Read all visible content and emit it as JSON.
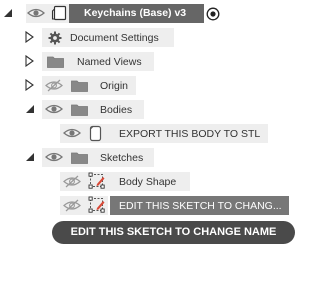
{
  "browser": {
    "root": {
      "label": "Keychains (Base) v3",
      "icons": [
        "collapse-arrow-icon",
        "eye-icon",
        "component-cube-icon",
        "active-radio-icon"
      ]
    },
    "items": [
      {
        "label": "Document Settings",
        "icons": [
          "expand-arrow-icon",
          "gear-icon"
        ]
      },
      {
        "label": "Named Views",
        "icons": [
          "expand-arrow-icon",
          "folder-icon"
        ]
      },
      {
        "label": "Origin",
        "icons": [
          "expand-arrow-icon",
          "eye-hidden-icon",
          "folder-icon"
        ]
      },
      {
        "label": "Bodies",
        "icons": [
          "collapse-arrow-icon",
          "eye-icon",
          "folder-icon"
        ]
      },
      {
        "label": "EXPORT THIS BODY TO STL",
        "icons": [
          "eye-icon",
          "body-icon"
        ]
      },
      {
        "label": "Sketches",
        "icons": [
          "collapse-arrow-icon",
          "eye-icon",
          "folder-icon"
        ]
      },
      {
        "label": "Body Shape",
        "icons": [
          "eye-hidden-icon",
          "sketch-icon"
        ]
      },
      {
        "label": "EDIT THIS SKETCH TO CHANG...",
        "state": "selected",
        "icons": [
          "eye-hidden-icon",
          "sketch-icon"
        ]
      }
    ]
  },
  "tooltip": {
    "text": "EDIT THIS SKETCH TO CHANGE NAME"
  },
  "colors": {
    "row_bg": "#eeeeee",
    "root_header": "#666666",
    "selected_row": "#777777",
    "tooltip_bg": "#4a4a4a",
    "folder": "#888888",
    "sketch_red": "#d94a38"
  }
}
